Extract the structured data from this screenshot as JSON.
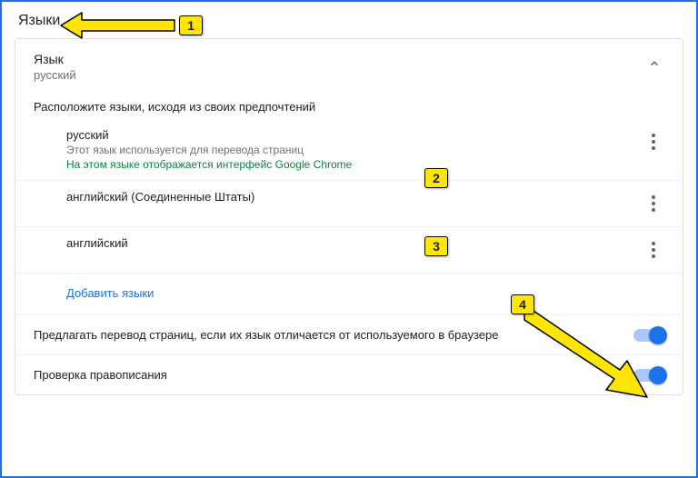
{
  "page": {
    "title": "Языки"
  },
  "panel": {
    "label": "Язык",
    "sublabel": "русский",
    "instruction": "Расположите языки, исходя из своих предпочтений",
    "add_link": "Добавить языки"
  },
  "languages": [
    {
      "name": "русский",
      "note": "Этот язык используется для перевода страниц",
      "green": "На этом языке отображается интерфейс Google Chrome"
    },
    {
      "name": "английский (Соединенные Штаты)",
      "note": "",
      "green": ""
    },
    {
      "name": "английский",
      "note": "",
      "green": ""
    }
  ],
  "toggles": {
    "translate": "Предлагать перевод страниц, если их язык отличается от используемого в браузере",
    "spellcheck": "Проверка правописания"
  },
  "annotations": {
    "b1": "1",
    "b2": "2",
    "b3": "3",
    "b4": "4"
  }
}
